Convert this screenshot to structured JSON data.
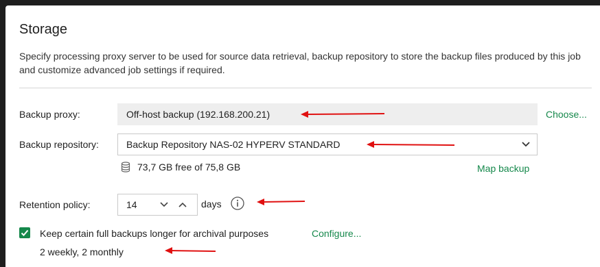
{
  "header": {
    "title": "Storage",
    "description": "Specify processing proxy server to be used for source data retrieval, backup repository to store the backup files produced by this job and customize advanced job settings if required."
  },
  "proxy": {
    "label": "Backup proxy:",
    "value": "Off-host backup (192.168.200.21)",
    "choose_link": "Choose..."
  },
  "repository": {
    "label": "Backup repository:",
    "value": "Backup Repository NAS-02 HYPERV STANDARD",
    "free_space": "73,7 GB free of 75,8 GB",
    "map_link": "Map backup"
  },
  "retention": {
    "label": "Retention policy:",
    "value": "14",
    "unit": "days"
  },
  "archival": {
    "checked": true,
    "label": "Keep certain full backups longer for archival purposes",
    "configure_link": "Configure...",
    "summary": "2 weekly, 2 monthly"
  },
  "colors": {
    "accent_green": "#15884b",
    "annotation_red": "#e01010"
  },
  "icons": [
    "database-icon",
    "chevron-down-icon",
    "chevron-up-icon",
    "info-icon",
    "checkmark-icon",
    "red-arrow"
  ]
}
